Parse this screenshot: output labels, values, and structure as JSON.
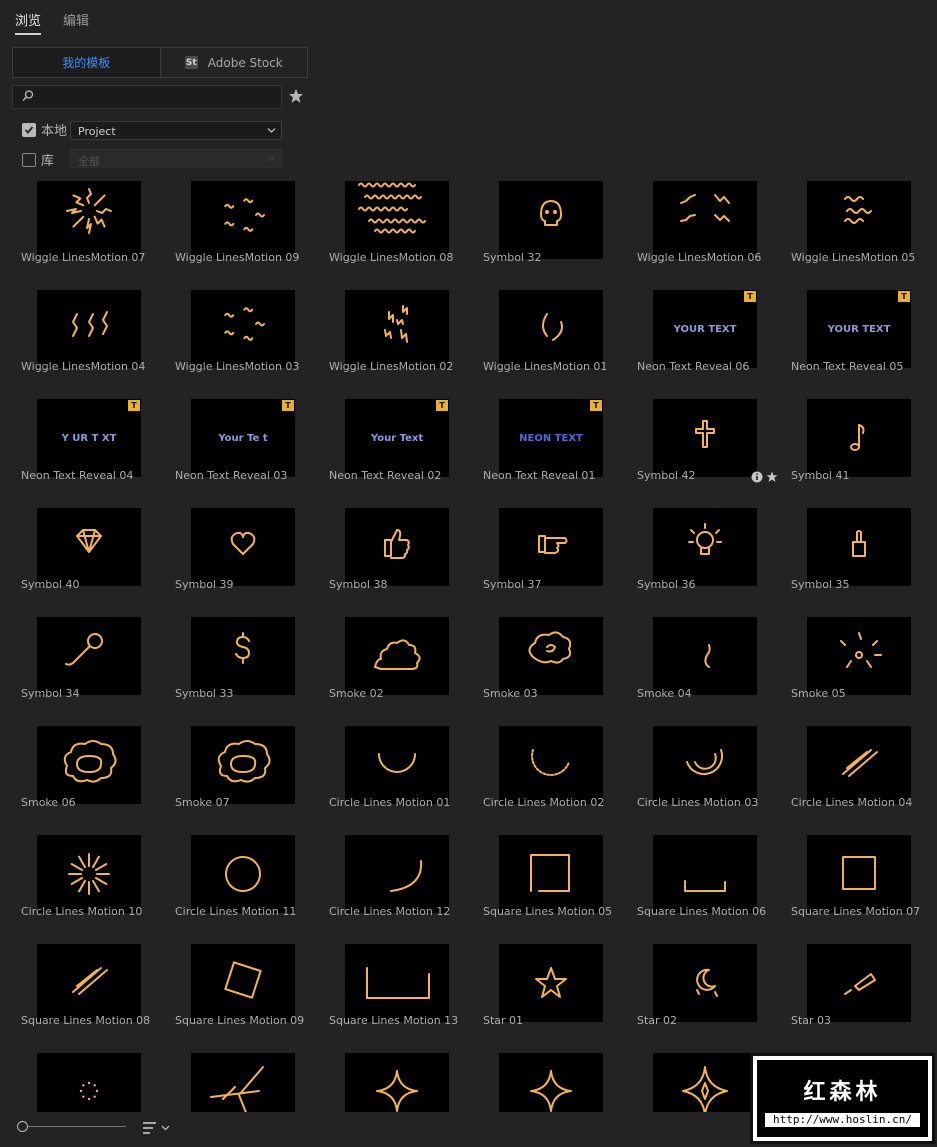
{
  "tabs": [
    "浏览",
    "编辑"
  ],
  "source": {
    "mine": "我的模板",
    "stock_icon": "St",
    "stock": "Adobe Stock"
  },
  "search": {
    "placeholder": ""
  },
  "filters": {
    "local": {
      "label": "本地",
      "checked": true,
      "value": "Project"
    },
    "library": {
      "label": "库",
      "checked": false,
      "value": "全部"
    }
  },
  "badge_text": "T",
  "items": [
    {
      "label": "Wiggle LinesMotion 07",
      "icon": "radial-wiggle"
    },
    {
      "label": "Wiggle LinesMotion 09",
      "icon": "circle-wiggle"
    },
    {
      "label": "Wiggle LinesMotion 08",
      "icon": "wavy-lines"
    },
    {
      "label": "Symbol 32",
      "icon": "skull"
    },
    {
      "label": "Wiggle LinesMotion 06",
      "icon": "corner-wiggle"
    },
    {
      "label": "Wiggle LinesMotion 05",
      "icon": "short-wavy"
    },
    {
      "label": "Wiggle LinesMotion 04",
      "icon": "vertical-wiggle"
    },
    {
      "label": "Wiggle LinesMotion 03",
      "icon": "circle-wiggle"
    },
    {
      "label": "Wiggle LinesMotion 02",
      "icon": "scatter-wiggle"
    },
    {
      "label": "Wiggle LinesMotion 01",
      "icon": "arc-wiggle"
    },
    {
      "label": "Neon Text Reveal 06",
      "icon": "text",
      "text": "YOUR TEXT",
      "badge": true
    },
    {
      "label": "Neon Text Reveal 05",
      "icon": "text",
      "text": "YOUR TEXT",
      "badge": true
    },
    {
      "label": "Neon Text Reveal 04",
      "icon": "text",
      "text": "Y UR T XT",
      "badge": true
    },
    {
      "label": "Neon Text Reveal 03",
      "icon": "text",
      "text": "Your Te t",
      "badge": true
    },
    {
      "label": "Neon Text Reveal 02",
      "icon": "text",
      "text": "Your Text",
      "badge": true
    },
    {
      "label": "Neon Text Reveal 01",
      "icon": "text",
      "text": "NEON TEXT",
      "badge": true
    },
    {
      "label": "Symbol 42",
      "icon": "cross",
      "hover": true
    },
    {
      "label": "Symbol 41",
      "icon": "music-note"
    },
    {
      "label": "Symbol 40",
      "icon": "diamond"
    },
    {
      "label": "Symbol 39",
      "icon": "heart"
    },
    {
      "label": "Symbol 38",
      "icon": "thumbs-up"
    },
    {
      "label": "Symbol 37",
      "icon": "pointing-hand"
    },
    {
      "label": "Symbol 36",
      "icon": "light-bulb"
    },
    {
      "label": "Symbol 35",
      "icon": "hand"
    },
    {
      "label": "Symbol 34",
      "icon": "microphone"
    },
    {
      "label": "Symbol 33",
      "icon": "dollar"
    },
    {
      "label": "Smoke 02",
      "icon": "smoke"
    },
    {
      "label": "Smoke 03",
      "icon": "smoke-cloud"
    },
    {
      "label": "Smoke 04",
      "icon": "wisp"
    },
    {
      "label": "Smoke 05",
      "icon": "burst"
    },
    {
      "label": "Smoke 06",
      "icon": "cloud-ring"
    },
    {
      "label": "Smoke 07",
      "icon": "cloud-ring"
    },
    {
      "label": "Circle Lines Motion 01",
      "icon": "arc-bottom"
    },
    {
      "label": "Circle Lines Motion 02",
      "icon": "arc-dotted"
    },
    {
      "label": "Circle Lines Motion 03",
      "icon": "arc-double"
    },
    {
      "label": "Circle Lines Motion 04",
      "icon": "slashes"
    },
    {
      "label": "Circle Lines Motion 10",
      "icon": "sunburst"
    },
    {
      "label": "Circle Lines Motion 11",
      "icon": "circle"
    },
    {
      "label": "Circle Lines Motion 12",
      "icon": "arc-quarter"
    },
    {
      "label": "Square Lines Motion 05",
      "icon": "square-open"
    },
    {
      "label": "Square Lines Motion 06",
      "icon": "bracket-bottom"
    },
    {
      "label": "Square Lines Motion 07",
      "icon": "square-dotted"
    },
    {
      "label": "Square Lines Motion 08",
      "icon": "slashes"
    },
    {
      "label": "Square Lines Motion 09",
      "icon": "square-rotated"
    },
    {
      "label": "Square Lines Motion 13",
      "icon": "bracket-wide"
    },
    {
      "label": "Star 01",
      "icon": "star"
    },
    {
      "label": "Star 02",
      "icon": "moon-stars"
    },
    {
      "label": "Star 03",
      "icon": "shooting-star"
    },
    {
      "label": "",
      "icon": "dots-circle"
    },
    {
      "label": "",
      "icon": "pinwheel"
    },
    {
      "label": "",
      "icon": "sparkle"
    },
    {
      "label": "",
      "icon": "sparkle"
    },
    {
      "label": "",
      "icon": "sparkle-star"
    },
    {
      "label": "",
      "icon": "burst"
    }
  ],
  "watermark": {
    "title": "红森林",
    "url": "http://www.hoslin.cn/"
  },
  "colors": {
    "accent": "#3a90ff",
    "neon": "#f3b457",
    "badge": "#e8b22e"
  }
}
